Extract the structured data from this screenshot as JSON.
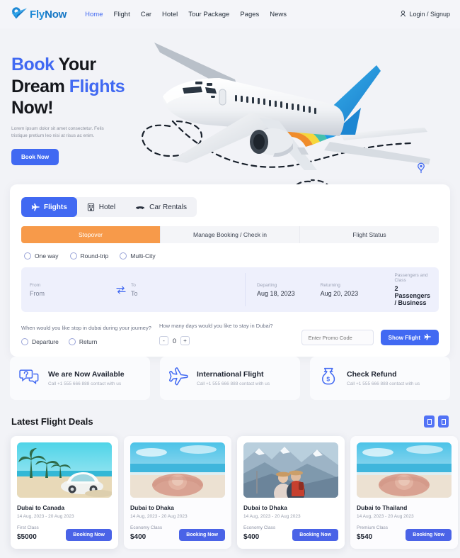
{
  "brand": {
    "name_part1": "Fly",
    "name_part2": "Now",
    "logo_icon": "location-pin-plane-icon"
  },
  "nav": {
    "links": [
      {
        "label": "Home",
        "active": true
      },
      {
        "label": "Flight",
        "active": false
      },
      {
        "label": "Car",
        "active": false
      },
      {
        "label": "Hotel",
        "active": false
      },
      {
        "label": "Tour Package",
        "active": false
      },
      {
        "label": "Pages",
        "active": false
      },
      {
        "label": "News",
        "active": false
      }
    ],
    "account_icon": "user-icon",
    "account_label": "Login / Signup"
  },
  "hero": {
    "title_line1_a": "Book",
    "title_line1_b": " Your",
    "title_line2_a": "Dream ",
    "title_line2_b": "Flights",
    "title_line3": "Now!",
    "subtitle": "Lorem ipsum dolor sit amet consectetur. Felis tristique pretium leo nisi at risus ac enim.",
    "cta_label": "Book Now",
    "airplane_icon": "airplane-illustration",
    "map_pin_icon": "map-pin-icon"
  },
  "search": {
    "type_tabs": [
      {
        "label": "Flights",
        "icon": "plane-icon",
        "active": true
      },
      {
        "label": "Hotel",
        "icon": "hotel-building-icon",
        "active": false
      },
      {
        "label": "Car Rentals",
        "icon": "car-icon",
        "active": false
      }
    ],
    "sub_tabs": [
      {
        "label": "Stopover",
        "active": true
      },
      {
        "label": "Manage Booking / Check in",
        "active": false
      },
      {
        "label": "Flight Status",
        "active": false
      }
    ],
    "trip_types": [
      {
        "label": "One way",
        "selected": false
      },
      {
        "label": "Round-trip",
        "selected": false
      },
      {
        "label": "Multi-City",
        "selected": false
      }
    ],
    "fields": {
      "from_label": "From",
      "from_value": "From",
      "swap_icon": "swap-arrows-icon",
      "to_label": "To",
      "to_value": "To",
      "departing_label": "Departing",
      "departing_value": "Aug 18, 2023",
      "returning_label": "Returning",
      "returning_value": "Aug 20, 2023",
      "passengers_label": "Passengers and Class",
      "passengers_value": "2 Passengers / Business"
    },
    "stopover_question": "When would you like stop in dubai during your journey?",
    "stopover_options": [
      {
        "label": "Departure",
        "selected": false
      },
      {
        "label": "Return",
        "selected": false
      }
    ],
    "days_question": "How many days would you like to stay in Dubai?",
    "days_minus": "-",
    "days_value": "0",
    "days_plus": "+",
    "promo_placeholder": "Enter Promo Code",
    "promo_value": "",
    "submit_label": "Show Flight",
    "submit_icon": "plane-icon"
  },
  "features": [
    {
      "icon": "chat-question-icon",
      "title": "We are Now Available",
      "subtitle": "Call +1 555 666 888 contact with us"
    },
    {
      "icon": "airplane-icon",
      "title": "International Flight",
      "subtitle": "Call +1 555 666 888 contact with us"
    },
    {
      "icon": "money-bag-icon",
      "title": "Check Refund",
      "subtitle": "Call +1 555 666 888 contact with us"
    }
  ],
  "deals": {
    "heading": "Latest Flight Deals",
    "prev_icon": "chevron-left-icon",
    "next_icon": "chevron-right-icon",
    "items": [
      {
        "image": "beach-palms-car-photo",
        "route": "Dubai to Canada",
        "dates": "14 Aug, 2023 - 20 Aug 2023",
        "travel_class": "First Class",
        "price": "$5000",
        "cta": "Booking Now"
      },
      {
        "image": "beach-hat-photo",
        "route": "Dubai to Dhaka",
        "dates": "14 Aug, 2023 - 20 Aug 2023",
        "travel_class": "Economy Class",
        "price": "$400",
        "cta": "Booking Now"
      },
      {
        "image": "mountain-hikers-photo",
        "route": "Dubai to Dhaka",
        "dates": "14 Aug, 2023 - 20 Aug 2023",
        "travel_class": "Economy Class",
        "price": "$400",
        "cta": "Booking Now"
      },
      {
        "image": "beach-hat-photo",
        "route": "Dubai to Thailand",
        "dates": "14 Aug, 2023 - 20 Aug 2023",
        "travel_class": "Premium Class",
        "price": "$540",
        "cta": "Booking Now"
      }
    ]
  },
  "colors": {
    "accent_blue": "#4169f2",
    "accent_orange": "#f79a4a",
    "page_bg": "#f2f3f7",
    "field_bg": "#eef0fc",
    "logo_blue": "#1f8ad6"
  }
}
